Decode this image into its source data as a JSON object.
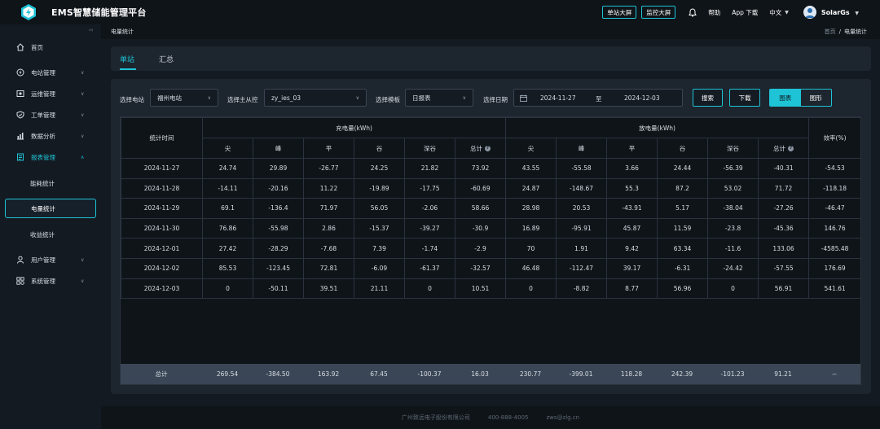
{
  "app": {
    "title": "EMS智慧储能管理平台"
  },
  "topbar": {
    "buttons": [
      "单站大屏",
      "监控大屏"
    ],
    "help": "帮助",
    "app_download": "App 下载",
    "language": "中文",
    "user_name": "SolarGs"
  },
  "sidebar": {
    "items": [
      {
        "label": "首页",
        "icon": "home-icon"
      },
      {
        "label": "电站管理",
        "icon": "power-station-icon"
      },
      {
        "label": "运维管理",
        "icon": "maintenance-icon"
      },
      {
        "label": "工单管理",
        "icon": "work-order-icon"
      },
      {
        "label": "数据分析",
        "icon": "analysis-icon"
      },
      {
        "label": "报表管理",
        "icon": "report-icon"
      },
      {
        "label": "用户管理",
        "icon": "user-icon"
      },
      {
        "label": "系统管理",
        "icon": "system-icon"
      }
    ],
    "report_sub": [
      "能耗统计",
      "电量统计",
      "收益统计"
    ]
  },
  "breadcrumb": {
    "title": "电量统计",
    "home": "首页",
    "sep": "/",
    "current": "电量统计"
  },
  "tabs": [
    "单站",
    "汇总"
  ],
  "filters": {
    "station_label": "选择电站",
    "station_value": "福州电站",
    "master_label": "选择主从控",
    "master_value": "zy_ies_03",
    "template_label": "选择模板",
    "template_value": "日报表",
    "date_label": "选择日期",
    "date_start": "2024-11-27",
    "date_to": "至",
    "date_end": "2024-12-03",
    "search": "搜索",
    "download": "下载",
    "view_table": "图表",
    "view_chart": "图形"
  },
  "table": {
    "time_header": "统计时间",
    "charge_header": "充电量(kWh)",
    "discharge_header": "放电量(kWh)",
    "efficiency_header": "效率(%)",
    "sub_headers": [
      "尖",
      "峰",
      "平",
      "谷",
      "深谷",
      "总计"
    ],
    "rows": [
      [
        "2024-11-27",
        "24.74",
        "29.89",
        "-26.77",
        "24.25",
        "21.82",
        "73.92",
        "43.55",
        "-55.58",
        "3.66",
        "24.44",
        "-56.39",
        "-40.31",
        "-54.53"
      ],
      [
        "2024-11-28",
        "-14.11",
        "-20.16",
        "11.22",
        "-19.89",
        "-17.75",
        "-60.69",
        "24.87",
        "-148.67",
        "55.3",
        "87.2",
        "53.02",
        "71.72",
        "-118.18"
      ],
      [
        "2024-11-29",
        "69.1",
        "-136.4",
        "71.97",
        "56.05",
        "-2.06",
        "58.66",
        "28.98",
        "20.53",
        "-43.91",
        "5.17",
        "-38.04",
        "-27.26",
        "-46.47"
      ],
      [
        "2024-11-30",
        "76.86",
        "-55.98",
        "2.86",
        "-15.37",
        "-39.27",
        "-30.9",
        "16.89",
        "-95.91",
        "45.87",
        "11.59",
        "-23.8",
        "-45.36",
        "146.76"
      ],
      [
        "2024-12-01",
        "27.42",
        "-28.29",
        "-7.68",
        "7.39",
        "-1.74",
        "-2.9",
        "70",
        "1.91",
        "9.42",
        "63.34",
        "-11.6",
        "133.06",
        "-4585.48"
      ],
      [
        "2024-12-02",
        "85.53",
        "-123.45",
        "72.81",
        "-6.09",
        "-61.37",
        "-32.57",
        "46.48",
        "-112.47",
        "39.17",
        "-6.31",
        "-24.42",
        "-57.55",
        "176.69"
      ],
      [
        "2024-12-03",
        "0",
        "-50.11",
        "39.51",
        "21.11",
        "0",
        "10.51",
        "0",
        "-8.82",
        "8.77",
        "56.96",
        "0",
        "56.91",
        "541.61"
      ]
    ],
    "total": [
      "总计",
      "269.54",
      "-384.50",
      "163.92",
      "67.45",
      "-100.37",
      "16.03",
      "230.77",
      "-399.01",
      "118.28",
      "242.39",
      "-101.23",
      "91.21",
      "--"
    ]
  },
  "footer": {
    "company": "广州致远电子股份有限公司",
    "phone": "400-888-4005",
    "email": "zws@zlg.cn"
  },
  "colors": {
    "accent": "#1ec3d6",
    "bg": "#141a22",
    "panel": "#1d252e",
    "total_row": "#3a4656"
  }
}
